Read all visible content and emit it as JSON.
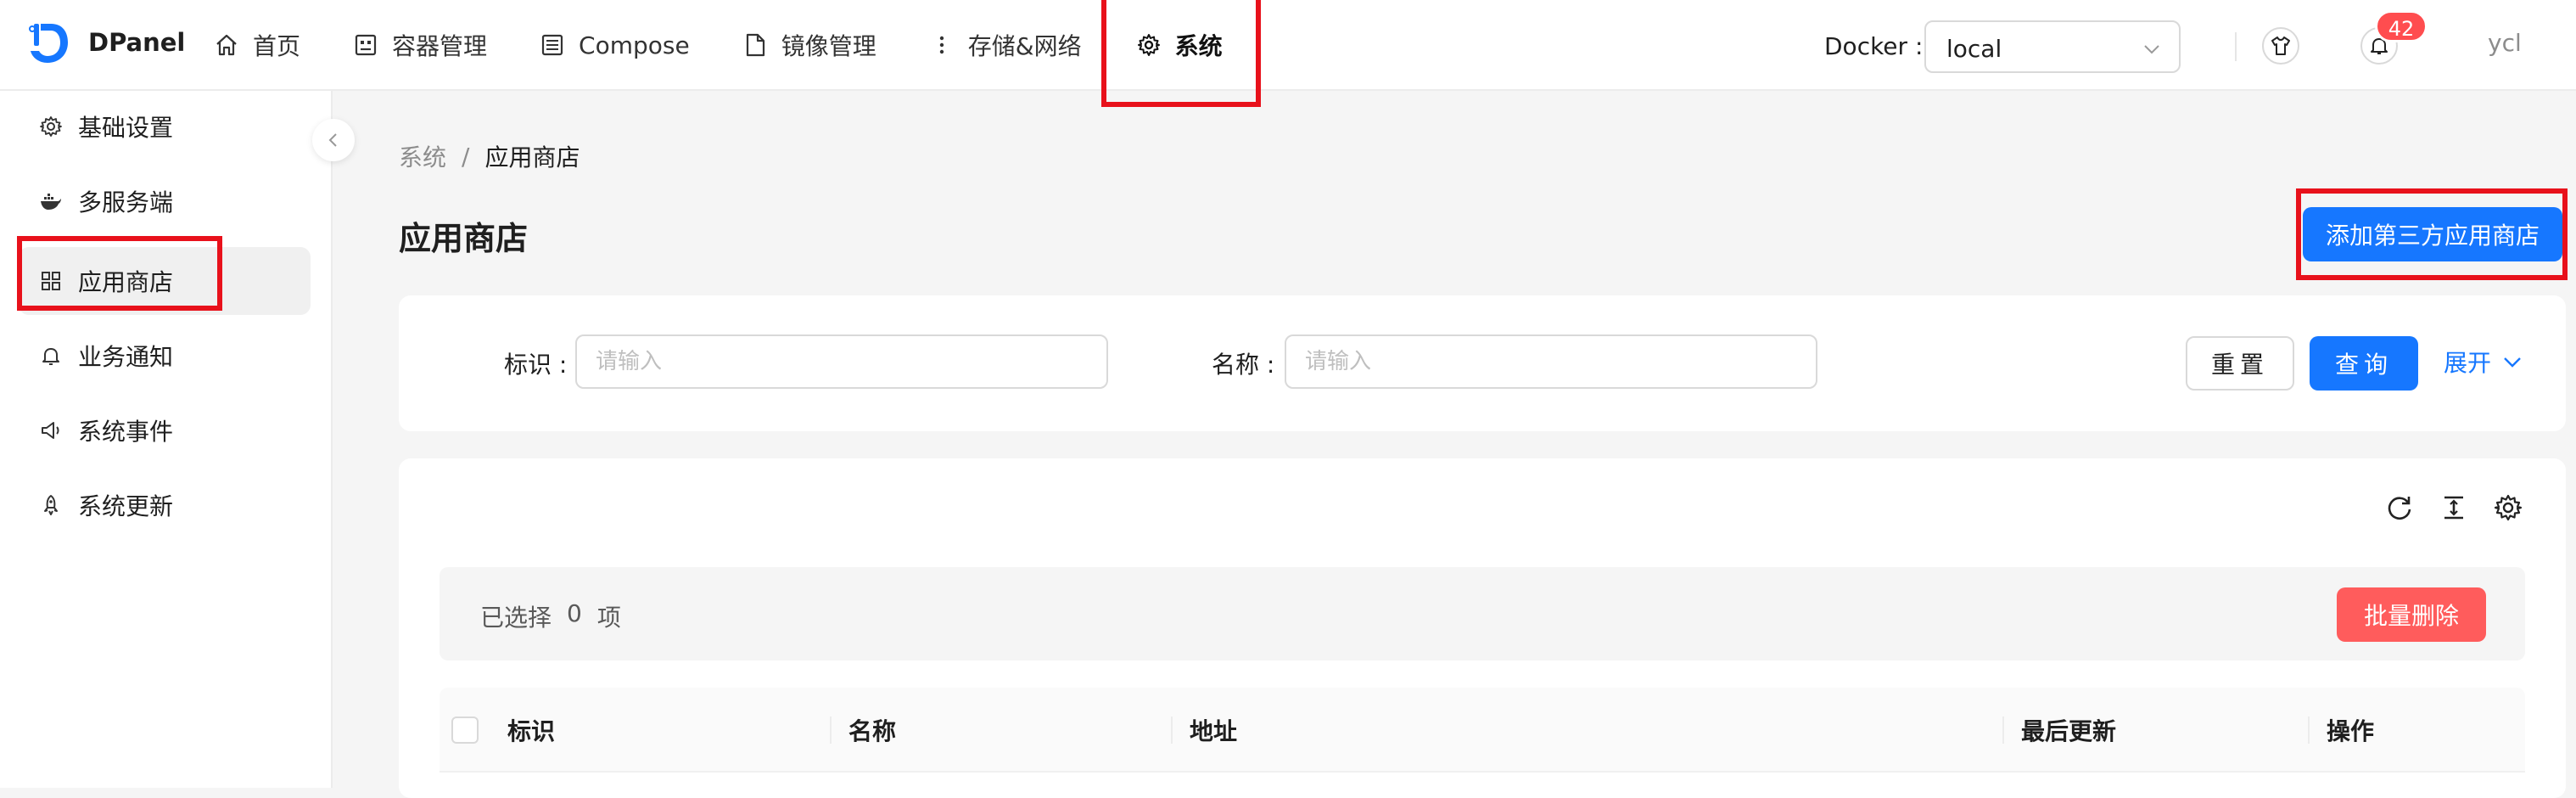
{
  "header": {
    "app_name": "DPanel",
    "nav": [
      {
        "label": "首页",
        "icon": "home-icon"
      },
      {
        "label": "容器管理",
        "icon": "container-icon"
      },
      {
        "label": "Compose",
        "icon": "compose-icon"
      },
      {
        "label": "镜像管理",
        "icon": "file-icon"
      },
      {
        "label": "存储&网络",
        "icon": "more-icon"
      },
      {
        "label": "系统",
        "icon": "gear-icon"
      }
    ],
    "active_nav": "系统",
    "docker_label": "Docker :",
    "docker_value": "local",
    "notification_count": "42",
    "user": "ycl"
  },
  "sidebar": {
    "items": [
      {
        "label": "基础设置",
        "icon": "gear-icon"
      },
      {
        "label": "多服务端",
        "icon": "docker-icon"
      },
      {
        "label": "应用商店",
        "icon": "grid-icon"
      },
      {
        "label": "业务通知",
        "icon": "bell-icon"
      },
      {
        "label": "系统事件",
        "icon": "sound-icon"
      },
      {
        "label": "系统更新",
        "icon": "rocket-icon"
      }
    ],
    "active": "应用商店"
  },
  "breadcrumb": {
    "parent": "系统",
    "separator": "/",
    "current": "应用商店"
  },
  "page": {
    "title": "应用商店",
    "add_button": "添加第三方应用商店"
  },
  "filter": {
    "fields": [
      {
        "label": "标识 :",
        "placeholder": "请输入"
      },
      {
        "label": "名称 :",
        "placeholder": "请输入"
      }
    ],
    "reset_label": "重置",
    "query_label": "查询",
    "expand_label": "展开"
  },
  "table": {
    "selection_prefix": "已选择",
    "selection_count": "0",
    "selection_suffix": "项",
    "batch_delete_label": "批量删除",
    "columns": [
      "标识",
      "名称",
      "地址",
      "最后更新",
      "操作"
    ]
  },
  "colors": {
    "primary": "#1677ff",
    "danger": "#ff5c5c",
    "highlight": "#e8111b",
    "badge": "#ff4d4f"
  }
}
